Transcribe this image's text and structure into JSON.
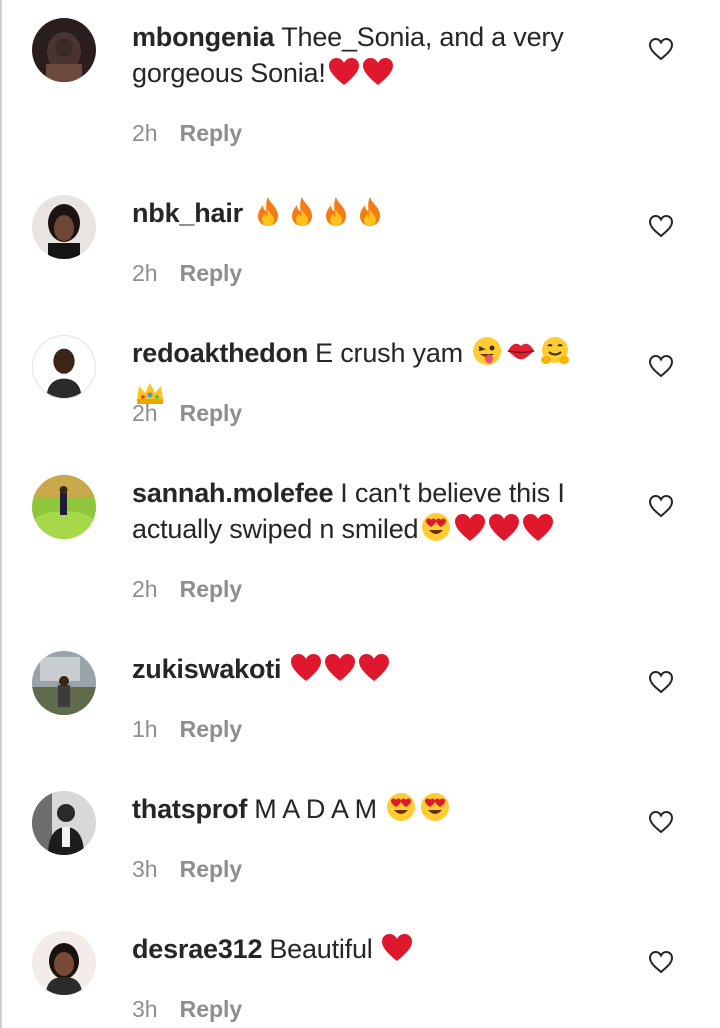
{
  "comments": [
    {
      "username": "mbongenia",
      "text": "Thee_Sonia, and a very gorgeous Sonia!",
      "time": "2h",
      "reply": "Reply",
      "emojis": [
        "red-heart",
        "red-heart"
      ]
    },
    {
      "username": "nbk_hair",
      "text": "",
      "time": "2h",
      "reply": "Reply",
      "emojis": [
        "fire",
        "fire",
        "fire",
        "fire"
      ]
    },
    {
      "username": "redoakthedon",
      "text": "E crush yam",
      "time": "2h",
      "reply": "Reply",
      "emojis": [
        "winking-tongue",
        "kiss-mark",
        "hugging-face",
        "crown"
      ]
    },
    {
      "username": "sannah.molefee",
      "text": "I can't believe this I actually swiped n smiled",
      "time": "2h",
      "reply": "Reply",
      "emojis": [
        "heart-eyes",
        "red-heart",
        "red-heart",
        "red-heart"
      ]
    },
    {
      "username": "zukiswakoti",
      "text": "",
      "time": "1h",
      "reply": "Reply",
      "emojis": [
        "red-heart",
        "red-heart",
        "red-heart"
      ]
    },
    {
      "username": "thatsprof",
      "text": "M A D A M",
      "time": "3h",
      "reply": "Reply",
      "emojis": [
        "heart-eyes",
        "heart-eyes"
      ]
    },
    {
      "username": "desrae312",
      "text": "Beautiful",
      "time": "3h",
      "reply": "Reply",
      "emojis": [
        "red-heart"
      ]
    }
  ],
  "colors": {
    "text": "#262626",
    "meta": "#8e8e8e",
    "heart": "#e0182d",
    "divider": "#cfcfcf"
  },
  "icons": {
    "like": "heart-outline-icon"
  }
}
